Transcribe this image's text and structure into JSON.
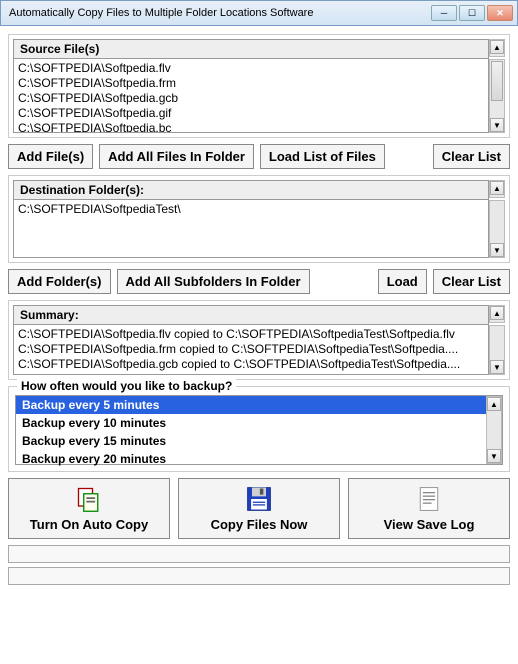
{
  "window": {
    "title": "Automatically Copy Files to Multiple Folder Locations Software"
  },
  "source": {
    "header": "Source File(s)",
    "items": [
      "C:\\SOFTPEDIA\\Softpedia.flv",
      "C:\\SOFTPEDIA\\Softpedia.frm",
      "C:\\SOFTPEDIA\\Softpedia.gcb",
      "C:\\SOFTPEDIA\\Softpedia.gif",
      "C:\\SOFTPEDIA\\Softpedia.bc"
    ],
    "buttons": {
      "add_files": "Add File(s)",
      "add_all": "Add All Files In Folder",
      "load_list": "Load List of Files",
      "clear": "Clear List"
    }
  },
  "destination": {
    "header": "Destination Folder(s):",
    "items": [
      "C:\\SOFTPEDIA\\SoftpediaTest\\"
    ],
    "buttons": {
      "add_folders": "Add Folder(s)",
      "add_subfolders": "Add All Subfolders In Folder",
      "load": "Load",
      "clear": "Clear List"
    }
  },
  "summary": {
    "header": "Summary:",
    "items": [
      "C:\\SOFTPEDIA\\Softpedia.flv copied to C:\\SOFTPEDIA\\SoftpediaTest\\Softpedia.flv",
      "C:\\SOFTPEDIA\\Softpedia.frm copied to C:\\SOFTPEDIA\\SoftpediaTest\\Softpedia....",
      "C:\\SOFTPEDIA\\Softpedia.gcb copied to C:\\SOFTPEDIA\\SoftpediaTest\\Softpedia...."
    ]
  },
  "backup": {
    "legend": "How often would you like to backup?",
    "options": [
      "Backup every 5 minutes",
      "Backup every 10 minutes",
      "Backup every 15 minutes",
      "Backup every 20 minutes"
    ],
    "selected_index": 0
  },
  "actions": {
    "auto_copy": "Turn On Auto Copy",
    "copy_now": "Copy Files Now",
    "view_log": "View Save Log"
  }
}
